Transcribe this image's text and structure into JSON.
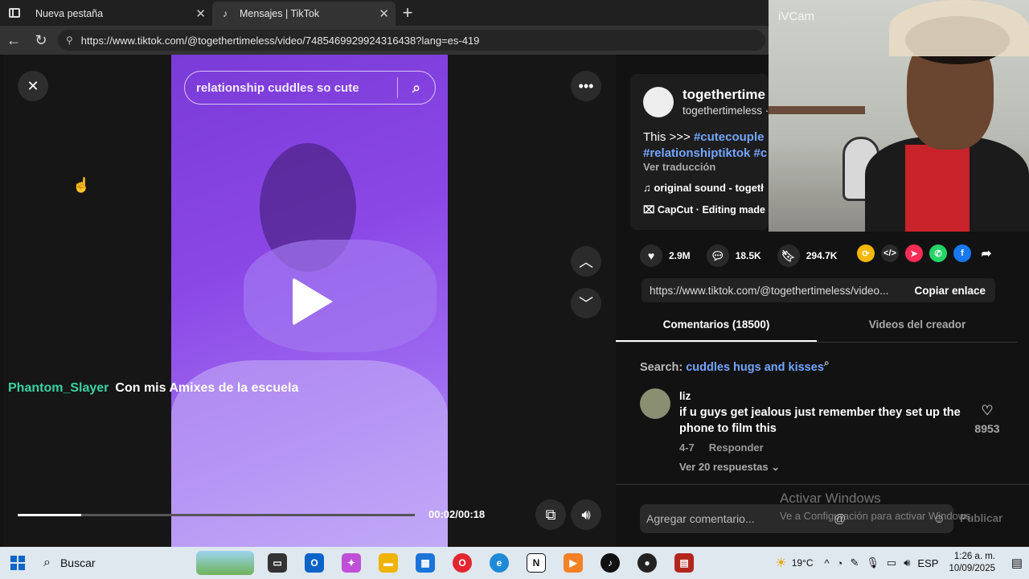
{
  "browser": {
    "tabs": [
      {
        "title": "Nueva pestaña",
        "active": false
      },
      {
        "title": "Mensajes | TikTok",
        "active": true
      }
    ],
    "url": "https://www.tiktok.com/@togethertimeless/video/7485469929924316438?lang=es-419"
  },
  "player": {
    "search_query": "relationship cuddles so cute",
    "overlay_user": "Phantom_Slayer",
    "overlay_message": "Con mis Amixes de la escuela",
    "time": "00:02/00:18",
    "progress_fraction": 0.16
  },
  "post": {
    "author": "togethertime",
    "handle": "togethertimeless ·",
    "caption_prefix": "This >>> ",
    "caption_tag1": "#cutecouple",
    "caption_tag2": "#relationshiptiktok",
    "caption_tag3": " #c",
    "translate": "Ver traducción",
    "music": "original sound - togetł",
    "capcut": "CapCut · Editing made e"
  },
  "stats": {
    "likes": "2.9M",
    "comments": "18.5K",
    "saves": "294.7K"
  },
  "share": {
    "link": "https://www.tiktok.com/@togethertimeless/video...",
    "copy_label": "Copiar enlace"
  },
  "tabs": {
    "comments": "Comentarios (18500)",
    "creator_videos": "Videos del creador"
  },
  "search_suggestion": {
    "label": "Search: ",
    "query": "cuddles hugs and kisses"
  },
  "comment": {
    "user": "liz",
    "text": "if u guys get jealous just remember they set up the phone to film this",
    "date": "4-7",
    "reply": "Responder",
    "view_replies": "Ver 20 respuestas",
    "likes": "8953"
  },
  "comment_bar": {
    "placeholder": "Agregar comentario...",
    "publish": "Publicar"
  },
  "windows_notice": {
    "title": "Activar Windows",
    "subtitle": "Ve a Configuración para activar Windows."
  },
  "webcam": {
    "watermark": "iVCam"
  },
  "taskbar": {
    "search": "Buscar",
    "temperature": "19°C",
    "language": "ESP",
    "time": "1:26 a. m.",
    "date": "10/09/2025"
  }
}
